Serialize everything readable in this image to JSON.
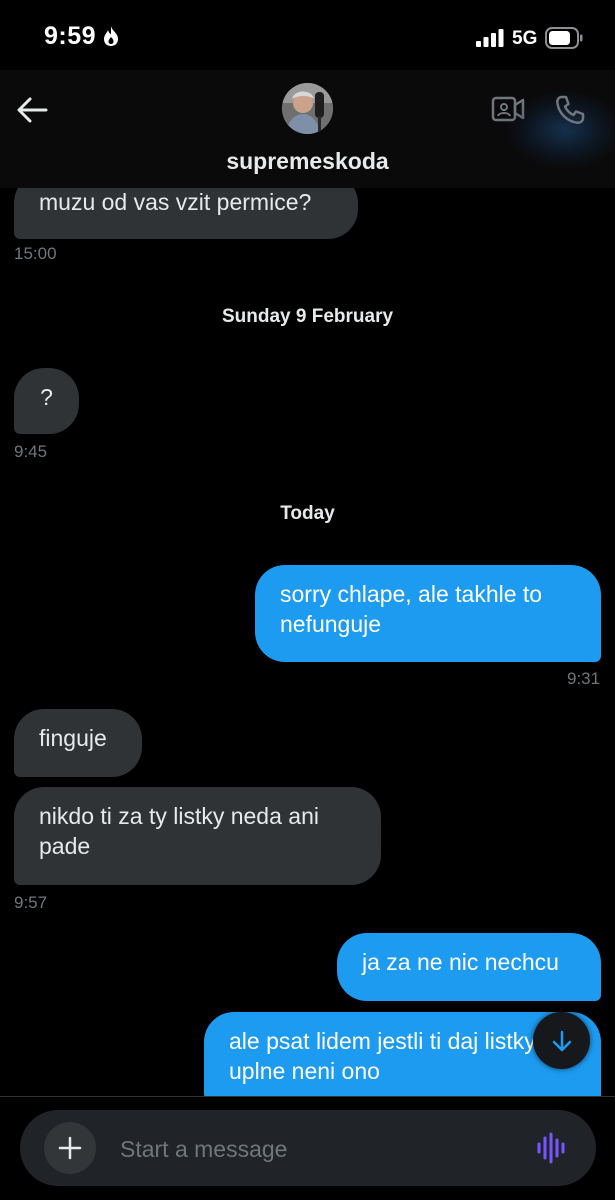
{
  "status_bar": {
    "time": "9:59",
    "network": "5G",
    "icons": [
      "flame-icon",
      "signal-icon",
      "battery-icon"
    ]
  },
  "header": {
    "contact_name": "supremeskoda",
    "back_icon": "back-arrow-icon",
    "video_icon": "video-call-icon",
    "call_icon": "phone-icon"
  },
  "messages": [
    {
      "direction": "in",
      "text": "muzu od vas vzit permice?",
      "time": "15:00"
    },
    {
      "type": "date",
      "label": "Sunday 9 February"
    },
    {
      "direction": "in",
      "text": "?",
      "time": "9:45"
    },
    {
      "type": "date",
      "label": "Today"
    },
    {
      "direction": "out",
      "text": "sorry chlape, ale takhle to nefunguje",
      "time": "9:31"
    },
    {
      "direction": "in",
      "text": "finguje"
    },
    {
      "direction": "in",
      "text": "nikdo ti za ty listky neda ani pade",
      "time": "9:57"
    },
    {
      "direction": "out",
      "text": "ja za ne nic nechcu"
    },
    {
      "direction": "out",
      "text": "ale psat lidem jestli ti daj listky uplne neni ono"
    }
  ],
  "composer": {
    "placeholder": "Start a message",
    "plus_icon": "plus-icon",
    "voice_icon": "voice-waveform-icon"
  },
  "colors": {
    "background": "#000000",
    "incoming_bubble": "#2f3336",
    "outgoing_bubble": "#1d9bf0",
    "timestamp": "#71767b",
    "voice_accent": "#7856ff"
  }
}
